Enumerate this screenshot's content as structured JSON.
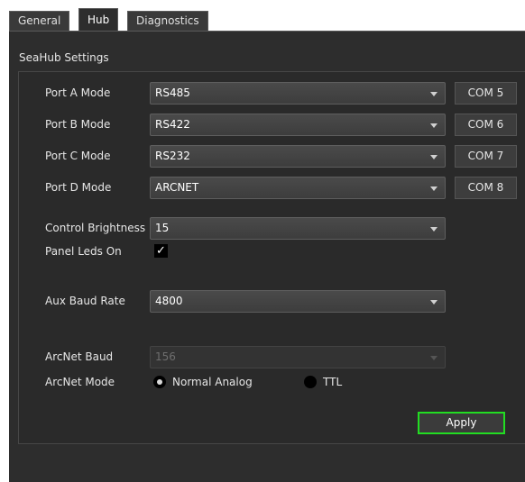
{
  "tabs": [
    {
      "label": "General",
      "active": false
    },
    {
      "label": "Hub",
      "active": true
    },
    {
      "label": "Diagnostics",
      "active": false
    }
  ],
  "group": {
    "title": "SeaHub Settings"
  },
  "ports": [
    {
      "label": "Port A Mode",
      "value": "RS485",
      "com": "COM 5"
    },
    {
      "label": "Port B Mode",
      "value": "RS422",
      "com": "COM 6"
    },
    {
      "label": "Port C Mode",
      "value": "RS232",
      "com": "COM 7"
    },
    {
      "label": "Port D Mode",
      "value": "ARCNET",
      "com": "COM 8"
    }
  ],
  "control_brightness": {
    "label": "Control Brightness",
    "value": "15"
  },
  "panel_leds": {
    "label": "Panel Leds On",
    "checked": true,
    "mark": "✓"
  },
  "aux_baud": {
    "label": "Aux Baud Rate",
    "value": "4800"
  },
  "arcnet_baud": {
    "label": "ArcNet Baud",
    "value": "156",
    "enabled": false
  },
  "arcnet_mode": {
    "label": "ArcNet Mode",
    "options": [
      {
        "label": "Normal Analog",
        "selected": true
      },
      {
        "label": "TTL",
        "selected": false
      }
    ]
  },
  "apply": {
    "label": "Apply"
  },
  "colors": {
    "panel": "#2d2d2d",
    "apply_border": "#22dd22",
    "text": "#e6e6e6"
  }
}
